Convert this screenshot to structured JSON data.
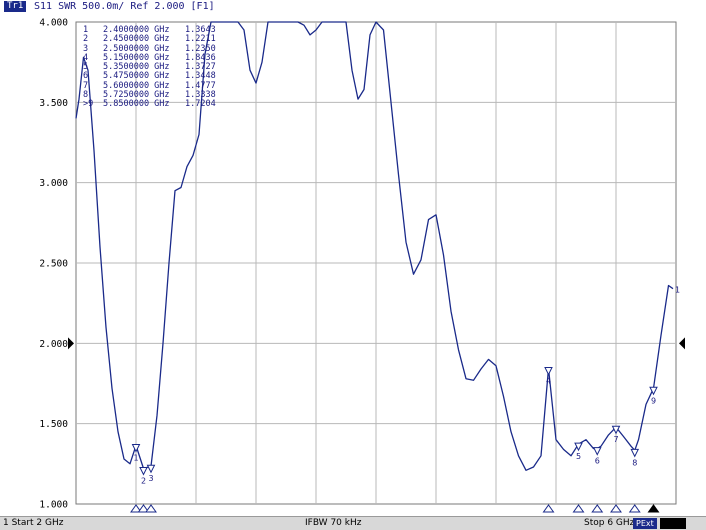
{
  "header": {
    "trace_badge": "Tr1",
    "trace_title": "S11  SWR 500.0m/ Ref 2.000 [F1]"
  },
  "status": {
    "channel": "1  Start 2 GHz",
    "ifbw": "IFBW 70 kHz",
    "stop": "Stop 6 GHz",
    "ext": "PExt"
  },
  "colors": {
    "trace": "#1a2a8a",
    "grid": "#b8b8b8",
    "text": "#1a1a80"
  },
  "chart_data": {
    "type": "line",
    "title": "S11  SWR 500.0m/ Ref 2.000 [F1]",
    "xlabel": "",
    "ylabel": "",
    "x_range_ghz": [
      2.0,
      6.0
    ],
    "ylim": [
      1.0,
      4.0
    ],
    "yticks": [
      "1.000",
      "1.500",
      "2.000",
      "2.500",
      "3.000",
      "3.500",
      "4.000"
    ],
    "grid": true,
    "reference_value": 2.0,
    "series": [
      {
        "x": [
          2.0,
          2.02,
          2.05,
          2.08,
          2.12,
          2.16,
          2.2,
          2.24,
          2.28,
          2.32,
          2.36,
          2.4,
          2.45,
          2.5,
          2.54,
          2.58,
          2.62,
          2.66,
          2.7,
          2.74,
          2.78,
          2.82,
          2.86,
          2.9,
          2.95,
          3.0,
          3.04,
          3.08,
          3.12,
          3.16,
          3.2,
          3.24,
          3.28,
          3.32,
          3.36,
          3.4,
          3.44,
          3.48,
          3.52,
          3.56,
          3.6,
          3.64,
          3.68,
          3.72,
          3.76,
          3.8,
          3.84,
          3.88,
          3.92,
          3.96,
          4.0,
          4.05,
          4.1,
          4.15,
          4.2,
          4.25,
          4.3,
          4.35,
          4.4,
          4.45,
          4.5,
          4.55,
          4.6,
          4.65,
          4.7,
          4.75,
          4.8,
          4.85,
          4.9,
          4.95,
          5.0,
          5.05,
          5.1,
          5.15,
          5.2,
          5.25,
          5.3,
          5.35,
          5.4,
          5.45,
          5.475,
          5.5,
          5.55,
          5.6,
          5.65,
          5.7,
          5.725,
          5.75,
          5.8,
          5.85,
          5.9,
          5.95,
          5.98
        ],
        "y": [
          3.4,
          3.52,
          3.78,
          3.7,
          3.2,
          2.6,
          2.1,
          1.72,
          1.45,
          1.28,
          1.25,
          1.364,
          1.221,
          1.235,
          1.55,
          2.0,
          2.5,
          2.95,
          2.97,
          3.1,
          3.17,
          3.3,
          3.8,
          4.0,
          4.0,
          4.0,
          4.0,
          4.0,
          3.95,
          3.7,
          3.62,
          3.75,
          4.0,
          4.0,
          4.0,
          4.0,
          4.0,
          4.0,
          3.98,
          3.92,
          3.95,
          4.0,
          4.0,
          4.0,
          4.0,
          4.0,
          3.7,
          3.52,
          3.58,
          3.92,
          4.0,
          3.95,
          3.5,
          3.05,
          2.63,
          2.43,
          2.52,
          2.77,
          2.8,
          2.55,
          2.2,
          1.96,
          1.78,
          1.77,
          1.84,
          1.9,
          1.86,
          1.67,
          1.45,
          1.3,
          1.21,
          1.23,
          1.3,
          1.844,
          1.4,
          1.34,
          1.3,
          1.373,
          1.4,
          1.345,
          1.345,
          1.36,
          1.43,
          1.478,
          1.42,
          1.36,
          1.334,
          1.4,
          1.62,
          1.72,
          2.05,
          2.36,
          2.34
        ]
      }
    ],
    "markers": [
      {
        "label": "1",
        "freq": "2.4000000 GHz",
        "value": "1.3643",
        "x": 2.4,
        "y": 1.3643
      },
      {
        "label": "2",
        "freq": "2.4500000 GHz",
        "value": "1.2211",
        "x": 2.45,
        "y": 1.2211
      },
      {
        "label": "3",
        "freq": "2.5000000 GHz",
        "value": "1.2350",
        "x": 2.5,
        "y": 1.235
      },
      {
        "label": "4",
        "freq": "5.1500000 GHz",
        "value": "1.8436",
        "x": 5.15,
        "y": 1.8436
      },
      {
        "label": "5",
        "freq": "5.3500000 GHz",
        "value": "1.3727",
        "x": 5.35,
        "y": 1.3727
      },
      {
        "label": "6",
        "freq": "5.4750000 GHz",
        "value": "1.3448",
        "x": 5.475,
        "y": 1.3448
      },
      {
        "label": "7",
        "freq": "5.6000000 GHz",
        "value": "1.4777",
        "x": 5.6,
        "y": 1.4777
      },
      {
        "label": "8",
        "freq": "5.7250000 GHz",
        "value": "1.3338",
        "x": 5.725,
        "y": 1.3338
      },
      {
        "label": ">9",
        "freq": "5.8500000 GHz",
        "value": "1.7204",
        "x": 5.85,
        "y": 1.7204
      }
    ],
    "trace_end_label": "1"
  }
}
